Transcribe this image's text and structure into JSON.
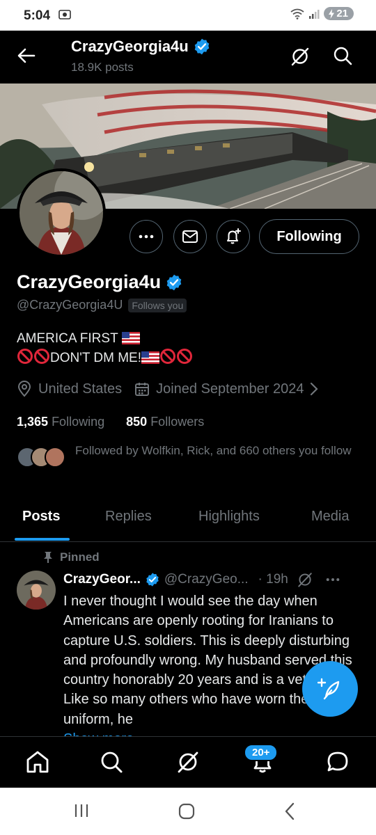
{
  "status_bar": {
    "time": "5:04",
    "battery": "21"
  },
  "top_bar": {
    "title": "CrazyGeorgia4u",
    "posts_count": "18.9K posts"
  },
  "profile": {
    "name": "CrazyGeorgia4u",
    "handle": "@CrazyGeorgia4U",
    "follows_you": "Follows you",
    "bio_line1": "AMERICA FIRST",
    "bio_line2_text": "DON'T DM ME!",
    "location": "United States",
    "joined": "Joined September 2024",
    "following_count": "1,365",
    "following_label": "Following",
    "followers_count": "850",
    "followers_label": "Followers",
    "followed_by": "Followed by Wolfkin, Rick, and 660 others you follow",
    "following_button": "Following"
  },
  "tabs": [
    "Posts",
    "Replies",
    "Highlights",
    "Media"
  ],
  "post": {
    "pinned_label": "Pinned",
    "author_name": "CrazyGeor...",
    "author_handle": "@CrazyGeo...",
    "time": "· 19h",
    "text": "I never thought I would see the day when Americans are openly rooting for Iranians to capture U.S. soldiers.  This is deeply disturbing and profoundly wrong.  My husband served this country honorably 20 years and is a veteran. Like so many others who have worn the uniform, he",
    "show_more": "Show more"
  },
  "bottom_nav": {
    "notif_badge": "20+"
  },
  "colors": {
    "accent": "#1d9bf0",
    "background": "#000000",
    "muted": "#71767b"
  }
}
